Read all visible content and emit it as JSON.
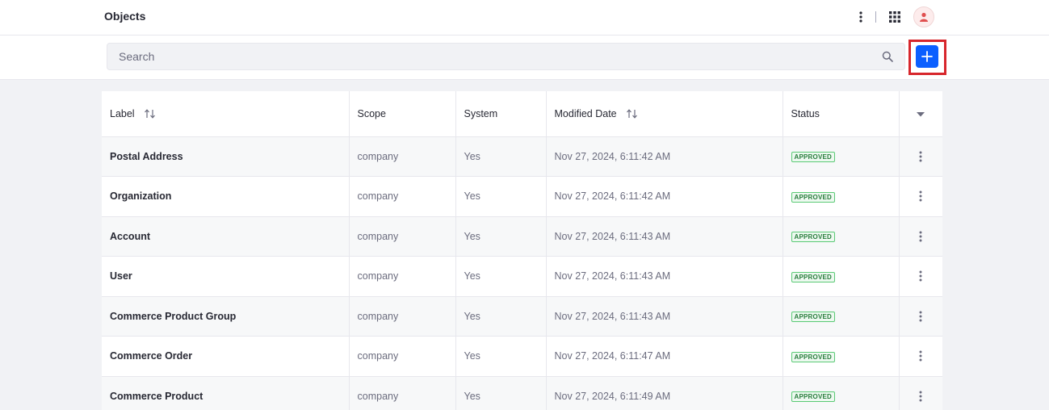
{
  "header": {
    "title": "Objects"
  },
  "search": {
    "placeholder": "Search",
    "value": ""
  },
  "table": {
    "columns": [
      "Label",
      "Scope",
      "System",
      "Modified Date",
      "Status"
    ],
    "rows": [
      {
        "label": "Postal Address",
        "scope": "company",
        "system": "Yes",
        "modified": "Nov 27, 2024, 6:11:42 AM",
        "status": "APPROVED"
      },
      {
        "label": "Organization",
        "scope": "company",
        "system": "Yes",
        "modified": "Nov 27, 2024, 6:11:42 AM",
        "status": "APPROVED"
      },
      {
        "label": "Account",
        "scope": "company",
        "system": "Yes",
        "modified": "Nov 27, 2024, 6:11:43 AM",
        "status": "APPROVED"
      },
      {
        "label": "User",
        "scope": "company",
        "system": "Yes",
        "modified": "Nov 27, 2024, 6:11:43 AM",
        "status": "APPROVED"
      },
      {
        "label": "Commerce Product Group",
        "scope": "company",
        "system": "Yes",
        "modified": "Nov 27, 2024, 6:11:43 AM",
        "status": "APPROVED"
      },
      {
        "label": "Commerce Order",
        "scope": "company",
        "system": "Yes",
        "modified": "Nov 27, 2024, 6:11:47 AM",
        "status": "APPROVED"
      },
      {
        "label": "Commerce Product",
        "scope": "company",
        "system": "Yes",
        "modified": "Nov 27, 2024, 6:11:49 AM",
        "status": "APPROVED"
      }
    ]
  },
  "icons": {
    "kebab": "kebab-icon",
    "apps": "apps-grid-icon",
    "avatar": "user-icon",
    "search": "search-icon",
    "add": "plus-icon",
    "sort": "sort-arrows-icon",
    "caret": "caret-down-icon"
  },
  "colors": {
    "primary": "#0b5fff",
    "highlight": "#d7262c",
    "status_approved": "#287d3c",
    "avatar_fg": "#e04f4f"
  }
}
